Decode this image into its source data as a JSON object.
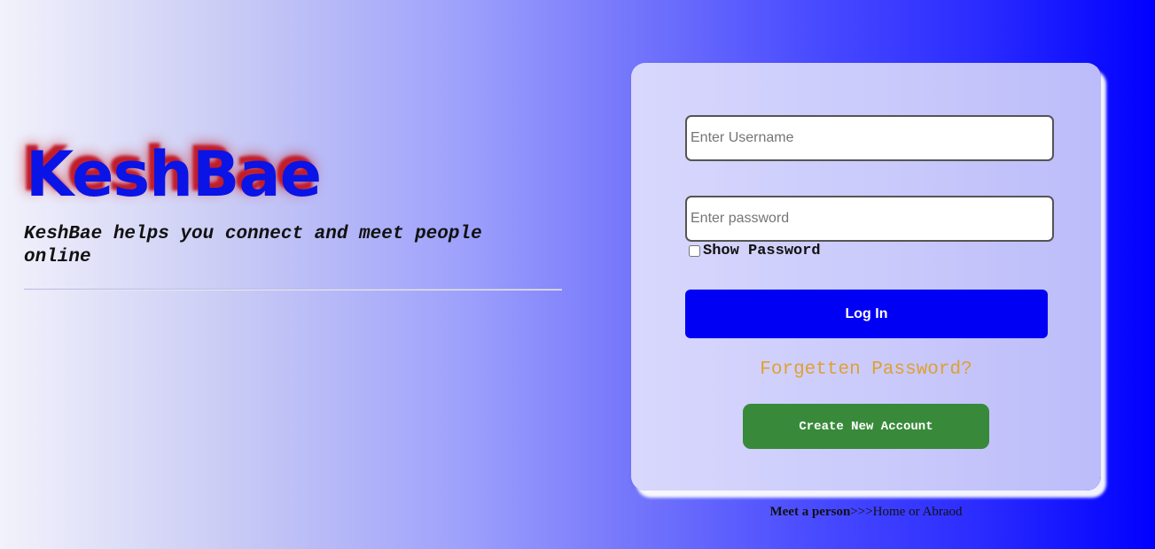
{
  "brand": {
    "logo_text": "KeshBae",
    "tagline": "KeshBae helps you connect and meet people online"
  },
  "login": {
    "username_placeholder": "Enter Username",
    "password_placeholder": "Enter password",
    "show_password_label": "Show Password",
    "login_button_label": "Log In",
    "forgot_password_link": "Forgetten Password?",
    "create_account_label": "Create New Account"
  },
  "footer": {
    "bold_text": "Meet a person",
    "rest_text": ">>>Home or Abraod"
  },
  "colors": {
    "logo": "#0a14e6",
    "logo_shadow": "#c21c2a",
    "login_button": "#0000f5",
    "create_button": "#388a3a",
    "forgot_link": "#e0a030"
  }
}
